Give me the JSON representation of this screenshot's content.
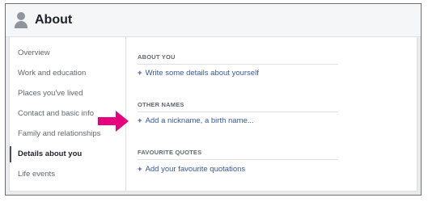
{
  "header": {
    "title": "About",
    "icon": "person-icon"
  },
  "sidebar": {
    "items": [
      {
        "label": "Overview",
        "active": false
      },
      {
        "label": "Work and education",
        "active": false
      },
      {
        "label": "Places you've lived",
        "active": false
      },
      {
        "label": "Contact and basic info",
        "active": false
      },
      {
        "label": "Family and relationships",
        "active": false
      },
      {
        "label": "Details about you",
        "active": true
      },
      {
        "label": "Life events",
        "active": false
      }
    ]
  },
  "main": {
    "sections": [
      {
        "heading": "ABOUT YOU",
        "link": "Write some details about yourself"
      },
      {
        "heading": "OTHER NAMES",
        "link": "Add a nickname, a birth name..."
      },
      {
        "heading": "FAVOURITE QUOTES",
        "link": "Add your favourite quotations"
      }
    ],
    "plus_symbol": "+"
  },
  "colors": {
    "link": "#365899",
    "arrow": "#e6007e",
    "header_bg": "#f5f6f7"
  }
}
